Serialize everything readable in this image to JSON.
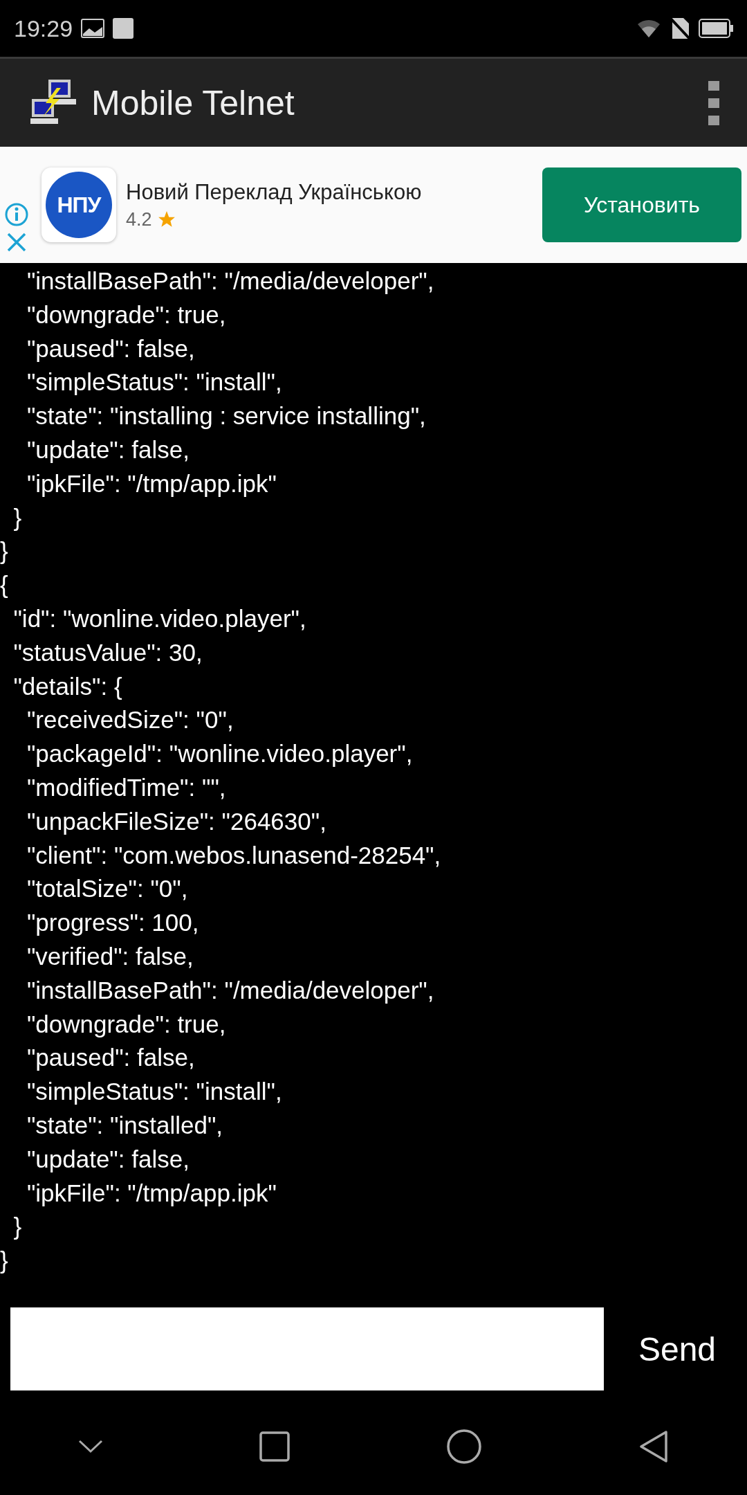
{
  "status_bar": {
    "time": "19:29"
  },
  "app_bar": {
    "title": "Mobile Telnet"
  },
  "ad": {
    "app_name": "Новий Переклад Українською",
    "icon_text": "НПУ",
    "rating": "4.2",
    "stars": 1,
    "install_button": "Установить"
  },
  "terminal": {
    "lines": [
      "    \"installBasePath\": \"/media/developer\",",
      "    \"downgrade\": true,",
      "    \"paused\": false,",
      "    \"simpleStatus\": \"install\",",
      "    \"state\": \"installing : service installing\",",
      "    \"update\": false,",
      "    \"ipkFile\": \"/tmp/app.ipk\"",
      "  }",
      "}",
      "{",
      "  \"id\": \"wonline.video.player\",",
      "  \"statusValue\": 30,",
      "  \"details\": {",
      "    \"receivedSize\": \"0\",",
      "    \"packageId\": \"wonline.video.player\",",
      "    \"modifiedTime\": \"\",",
      "    \"unpackFileSize\": \"264630\",",
      "    \"client\": \"com.webos.lunasend-28254\",",
      "    \"totalSize\": \"0\",",
      "    \"progress\": 100,",
      "    \"verified\": false,",
      "    \"installBasePath\": \"/media/developer\",",
      "    \"downgrade\": true,",
      "    \"paused\": false,",
      "    \"simpleStatus\": \"install\",",
      "    \"state\": \"installed\",",
      "    \"update\": false,",
      "    \"ipkFile\": \"/tmp/app.ipk\"",
      "  }",
      "}"
    ]
  },
  "input_bar": {
    "send_button": "Send"
  }
}
